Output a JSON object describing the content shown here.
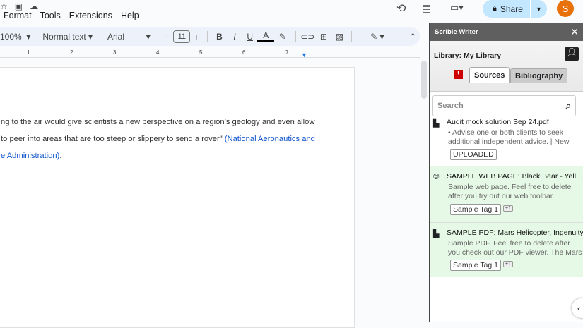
{
  "menu": [
    "Format",
    "Tools",
    "Extensions",
    "Help"
  ],
  "toolbar": {
    "zoom": "100%",
    "style": "Normal text",
    "font": "Arial",
    "font_size": "11"
  },
  "ruler": [
    "1",
    "2",
    "3",
    "4",
    "5",
    "6",
    "7"
  ],
  "doc": {
    "line1": "ng to the air would give scientists a new perspective on a region’s geology and even allow",
    "line2": " to peer into areas that are too steep or slippery to send a rover\" ",
    "link1": "(National Aeronautics and",
    "link2": "e Administration)",
    "tail": "."
  },
  "header": {
    "share": "Share",
    "avatar": "S"
  },
  "sidebar": {
    "title": "Scrible Writer",
    "library": "Library: My Library",
    "tabs": [
      "Sources",
      "Bibliography"
    ],
    "search_placeholder": "Search",
    "items": [
      {
        "title": "Audit mock solution Sep 24.pdf",
        "desc": "• Advise one or both clients to seek additional independent advice. | New",
        "tag": "UPLOADED"
      },
      {
        "title": "SAMPLE WEB PAGE: Black Bear - Yell...",
        "desc": "Sample web page. Feel free to delete after you try out our web toolbar.",
        "tag": "Sample Tag 1",
        "more": "+1"
      },
      {
        "title": "SAMPLE PDF: Mars Helicopter, Ingenuity",
        "desc": "Sample PDF. Feel free to delete after you check out our PDF viewer. The Mars",
        "tag": "Sample Tag 1",
        "more": "+1"
      }
    ]
  },
  "colors": {
    "accent": "#1a73e8",
    "share_bg": "#c2e7ff",
    "avatar": "#e8710a",
    "item_highlight": "#e6f9e6"
  }
}
